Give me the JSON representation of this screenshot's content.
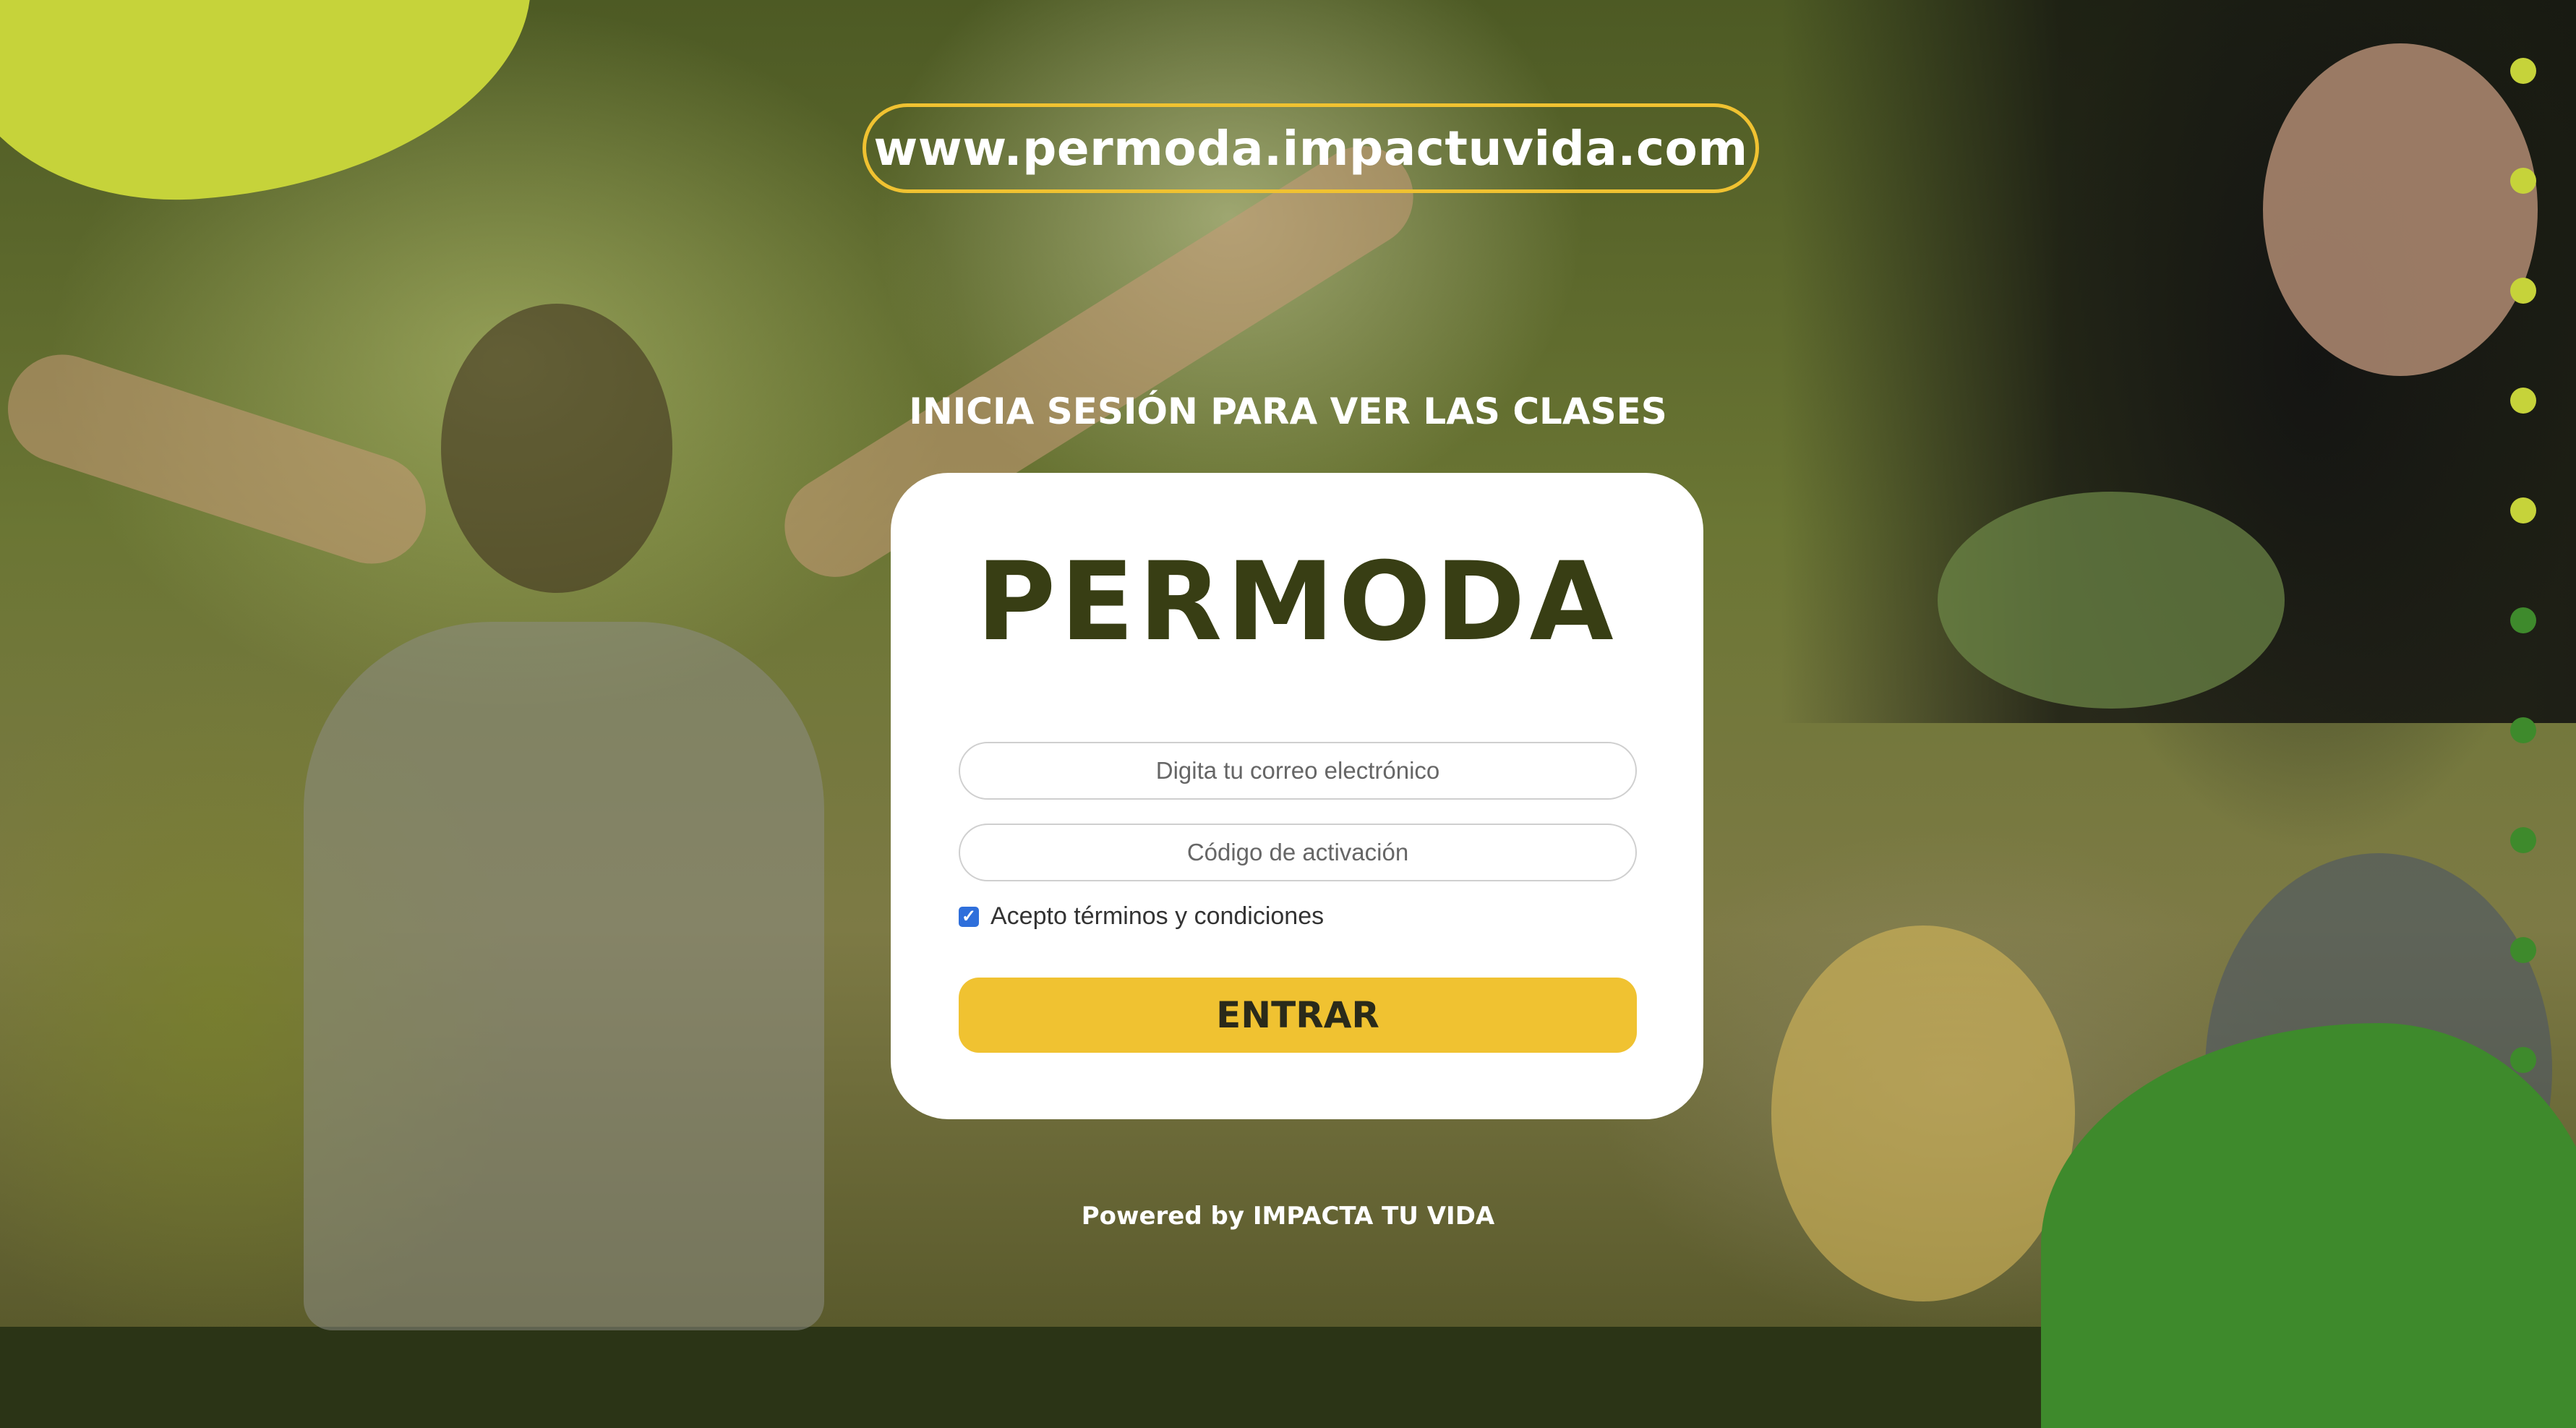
{
  "url_banner": "www.permoda.impactuvida.com",
  "login_heading": "INICIA SESIÓN PARA VER LAS CLASES",
  "card": {
    "brand": "PERMODA",
    "email_placeholder": "Digita tu correo electrónico",
    "code_placeholder": "Código de activación",
    "terms_label": "Acepto términos y condiciones",
    "terms_checked": true,
    "submit_label": "ENTRAR"
  },
  "footer": {
    "powered_prefix": "Powered by ",
    "powered_brand": "IMPACTA TU VIDA"
  },
  "colors": {
    "accent_yellow": "#f0c231",
    "brand_text": "#383e14",
    "blob_lime": "#c6d33a",
    "blob_green": "#3e8a2c",
    "checkbox_blue": "#2f6fdb"
  },
  "decor_dots": [
    "lime",
    "lime",
    "lime",
    "lime",
    "lime",
    "green",
    "green",
    "green",
    "green",
    "green"
  ]
}
